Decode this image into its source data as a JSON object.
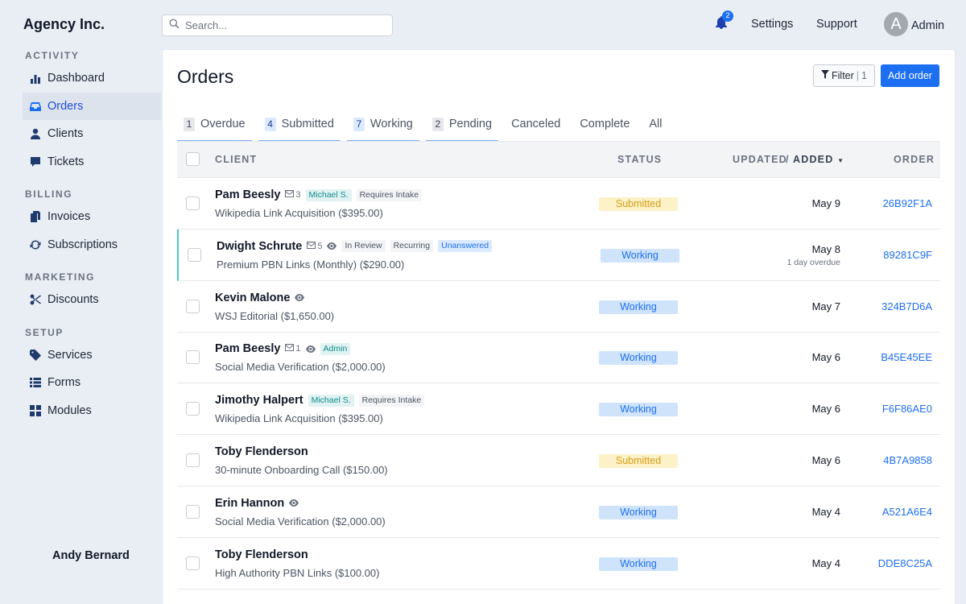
{
  "brand": "Agency Inc.",
  "search": {
    "placeholder": "Search..."
  },
  "topbar": {
    "notifications_count": "2",
    "settings_label": "Settings",
    "support_label": "Support",
    "avatar_initial": "A",
    "user_label": "Admin"
  },
  "sidebar": {
    "sections": [
      {
        "label": "ACTIVITY",
        "items": [
          {
            "label": "Dashboard",
            "icon": "bar-chart-icon"
          },
          {
            "label": "Orders",
            "icon": "inbox-icon",
            "active": true
          },
          {
            "label": "Clients",
            "icon": "user-icon"
          },
          {
            "label": "Tickets",
            "icon": "chat-icon"
          }
        ]
      },
      {
        "label": "BILLING",
        "items": [
          {
            "label": "Invoices",
            "icon": "invoice-icon"
          },
          {
            "label": "Subscriptions",
            "icon": "refresh-icon"
          }
        ]
      },
      {
        "label": "MARKETING",
        "items": [
          {
            "label": "Discounts",
            "icon": "scissors-icon"
          }
        ]
      },
      {
        "label": "SETUP",
        "items": [
          {
            "label": "Services",
            "icon": "tag-icon"
          },
          {
            "label": "Forms",
            "icon": "list-icon"
          },
          {
            "label": "Modules",
            "icon": "grid-icon"
          }
        ]
      }
    ]
  },
  "main": {
    "title": "Orders",
    "filter_label": "Filter",
    "filter_count": "1",
    "add_order_label": "Add order",
    "tabs": [
      {
        "count": "1",
        "label": "Overdue"
      },
      {
        "count": "4",
        "label": "Submitted"
      },
      {
        "count": "7",
        "label": "Working"
      },
      {
        "count": "2",
        "label": "Pending"
      },
      {
        "count": "",
        "label": "Canceled"
      },
      {
        "count": "",
        "label": "Complete"
      },
      {
        "count": "",
        "label": "All"
      }
    ],
    "table": {
      "headers": {
        "client": "CLIENT",
        "status": "STATUS",
        "updated": "UPDATED",
        "slash": "/",
        "added": "ADDED",
        "order": "ORDER"
      },
      "rows": [
        {
          "client": "Pam Beesly",
          "messages": "3",
          "eye": false,
          "tags": [
            [
              "Michael S.",
              "teal"
            ],
            [
              "Requires Intake",
              "gray"
            ]
          ],
          "service": "Wikipedia Link Acquisition ($395.00)",
          "status": "Submitted",
          "status_type": "submitted",
          "date": "May 9",
          "overdue": "",
          "order": "26B92F1A",
          "highlight": false
        },
        {
          "client": "Dwight Schrute",
          "messages": "5",
          "eye": true,
          "tags": [
            [
              "In Review",
              "gray"
            ],
            [
              "Recurring",
              "gray"
            ],
            [
              "Unanswered",
              "blue"
            ]
          ],
          "service": "Premium PBN Links (Monthly) ($290.00)",
          "status": "Working",
          "status_type": "working",
          "date": "May 8",
          "overdue": "1 day overdue",
          "order": "89281C9F",
          "highlight": true
        },
        {
          "client": "Kevin Malone",
          "messages": "",
          "eye": true,
          "tags": [],
          "service": "WSJ Editorial ($1,650.00)",
          "status": "Working",
          "status_type": "working",
          "date": "May 7",
          "overdue": "",
          "order": "324B7D6A",
          "highlight": false
        },
        {
          "client": "Pam Beesly",
          "messages": "1",
          "eye": true,
          "tags": [
            [
              "Admin",
              "teal"
            ]
          ],
          "service": "Social Media Verification ($2,000.00)",
          "status": "Working",
          "status_type": "working",
          "date": "May 6",
          "overdue": "",
          "order": "B45E45EE",
          "highlight": false
        },
        {
          "client": "Jimothy Halpert",
          "messages": "",
          "eye": false,
          "tags": [
            [
              "Michael S.",
              "teal"
            ],
            [
              "Requires Intake",
              "gray"
            ]
          ],
          "service": "Wikipedia Link Acquisition ($395.00)",
          "status": "Working",
          "status_type": "working",
          "date": "May 6",
          "overdue": "",
          "order": "F6F86AE0",
          "highlight": false
        },
        {
          "client": "Toby Flenderson",
          "messages": "",
          "eye": false,
          "tags": [],
          "service": "30-minute Onboarding Call ($150.00)",
          "status": "Submitted",
          "status_type": "submitted",
          "date": "May 6",
          "overdue": "",
          "order": "4B7A9858",
          "highlight": false
        },
        {
          "client": "Erin Hannon",
          "messages": "",
          "eye": true,
          "tags": [],
          "service": "Social Media Verification ($2,000.00)",
          "status": "Working",
          "status_type": "working",
          "date": "May 4",
          "overdue": "",
          "order": "A521A6E4",
          "highlight": false
        },
        {
          "client": "Toby Flenderson",
          "messages": "",
          "eye": false,
          "tags": [],
          "service": "High Authority PBN Links ($100.00)",
          "status": "Working",
          "status_type": "working",
          "date": "May 4",
          "overdue": "",
          "order": "DDE8C25A",
          "highlight": false
        }
      ],
      "next_row_partial": "Andy Bernard"
    }
  }
}
